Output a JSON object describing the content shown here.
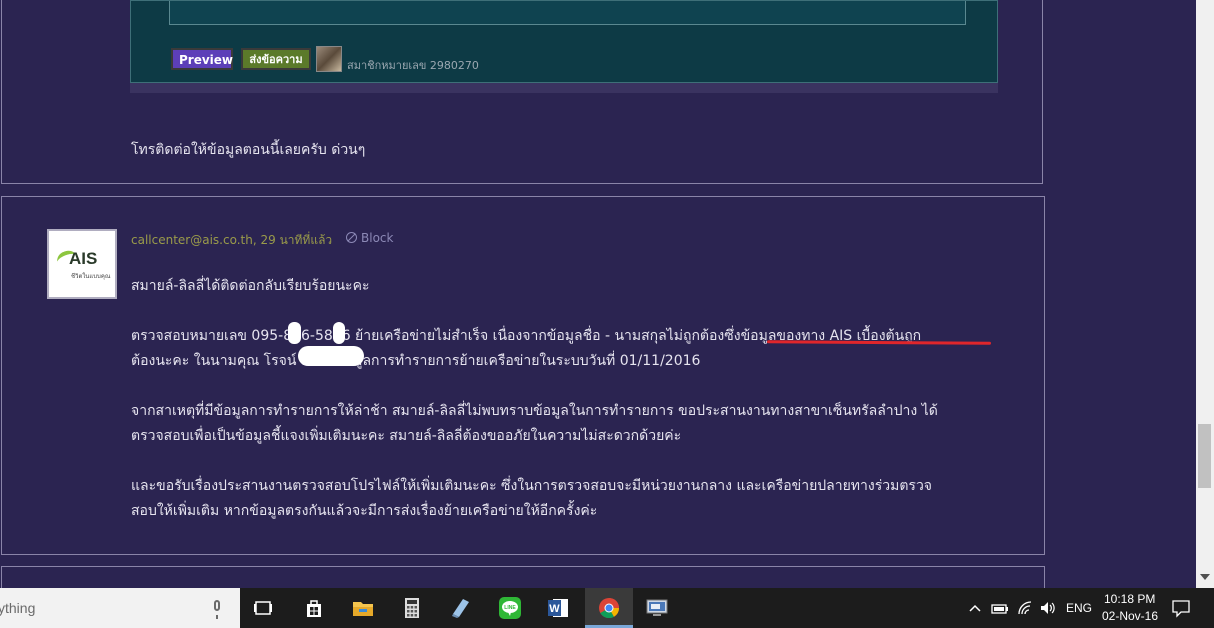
{
  "top_card": {
    "preview_label": "Preview",
    "send_label": "ส่งข้อความ",
    "member_label": "สมาชิกหมายเลข 2980270",
    "comment_text": "โทรติดต่อให้ข้อมูลตอนนี้เลยครับ ด่วนๆ"
  },
  "main_card": {
    "author_email": "callcenter@ais.co.th,",
    "time_ago": "29 นาทีที่แล้ว",
    "block_label": "Block",
    "avatar_logo": "AIS",
    "avatar_sub": "ชีวิตในแบบคุณ",
    "p1": "สมายล์-ลิลลี่ได้ติดต่อกลับเรียบร้อยนะคะ",
    "p2_line1": "ตรวจสอบหมายเลข 095-846-5846 ย้ายเครือข่ายไม่สำเร็จ เนื่องจากข้อมูลชื่อ - นามสกุลไม่ถูกต้องซึ่งข้อมูลของทาง AIS เบื้องต้นถูก",
    "p2_line2": "ต้องนะคะ ในนามคุณ โรจน์           และมีข้อมูลการทำรายการย้ายเครือข่ายในระบบวันที่ 01/11/2016",
    "p3_line1": "จากสาเหตุที่มีข้อมูลการทำรายการให้ล่าช้า สมายล์-ลิลลี่ไม่พบทราบข้อมูลในการทำรายการ ขอประสานงานทางสาขาเซ็นทรัลลำปาง ได้",
    "p3_line2": "ตรวจสอบเพื่อเป็นข้อมูลชี้แจงเพิ่มเติมนะคะ สมายล์-ลิลลี่ต้องขออภัยในความไม่สะดวกด้วยค่ะ",
    "p4_line1": "และขอรับเรื่องประสานงานตรวจสอบโปรไฟล์ให้เพิ่มเติมนะคะ ซึ่งในการตรวจสอบจะมีหน่วยงานกลาง และเครือข่ายปลายทางร่วมตรวจ",
    "p4_line2": "สอบให้เพิ่มเติม หากข้อมูลตรงกันแล้วจะมีการส่งเรื่องย้ายเครือข่ายให้อีกครั้งค่ะ"
  },
  "taskbar": {
    "search_placeholder": "ything",
    "language": "ENG",
    "time": "10:18 PM",
    "date": "02-Nov-16",
    "icons": [
      "task-view-icon",
      "store-icon",
      "file-explorer-icon",
      "calculator-icon",
      "notepad-icon",
      "line-app-icon",
      "word-icon",
      "chrome-icon",
      "remote-desktop-icon"
    ]
  },
  "colors": {
    "page_bg": "#2b2451",
    "editor_bg": "#0d3a45",
    "author_color": "#9a9b4a",
    "highlight_line": "#e0262b"
  }
}
